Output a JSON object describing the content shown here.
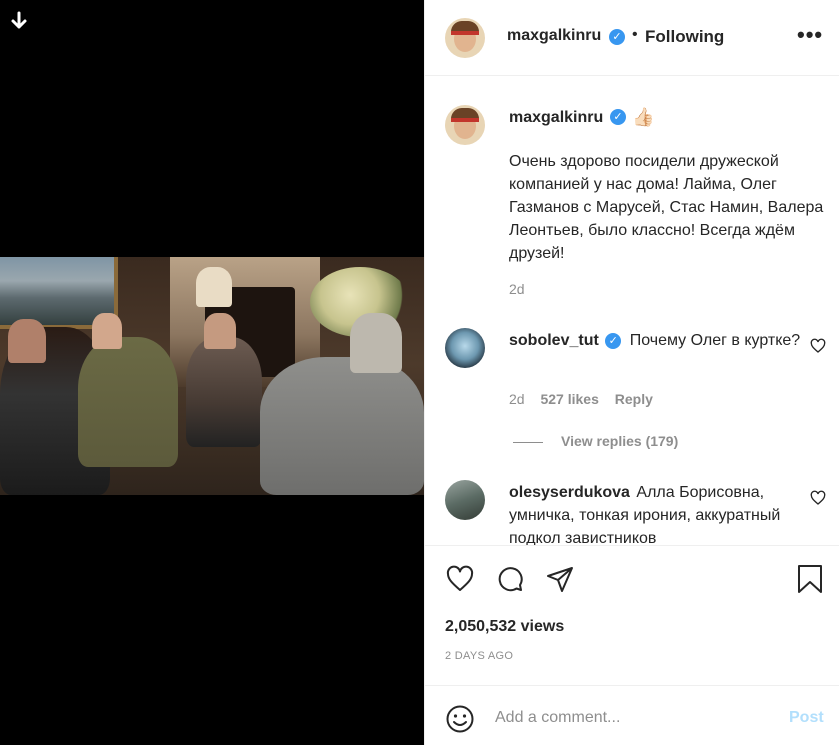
{
  "post": {
    "username": "maxgalkinru",
    "follow_status": "Following",
    "separator": "•",
    "more_icon": "more-horizontal-icon"
  },
  "caption": {
    "username": "maxgalkinru",
    "emoji": "👍🏻",
    "text": "Очень здорово посидели дружеской компанией у нас дома! Лайма, Олег Газманов с Марусей, Стас Намин, Валера Леонтьев, было классно! Всегда ждём друзей!",
    "time": "2d"
  },
  "comments": [
    {
      "username": "sobolev_tut",
      "verified": true,
      "text": "Почему Олег в куртке?",
      "time": "2d",
      "likes": "527 likes",
      "reply_label": "Reply",
      "view_replies": "View replies (179)"
    },
    {
      "username": "olesyserdukova",
      "verified": false,
      "text": "Алла Борисовна, умничка, тонкая ирония, аккуратный подкол завистников"
    }
  ],
  "stats": {
    "views": "2,050,532 views",
    "date": "2 DAYS AGO"
  },
  "composer": {
    "placeholder": "Add a comment...",
    "post_label": "Post"
  },
  "colors": {
    "verified": "#3897f0",
    "post_disabled": "#b2dffc",
    "secondary_text": "#8e8e8e",
    "media_background": "#000000"
  },
  "icons": [
    "download-arrow-icon",
    "verified-badge-icon",
    "heart-icon",
    "comment-icon",
    "share-icon",
    "bookmark-icon",
    "emoji-icon"
  ]
}
